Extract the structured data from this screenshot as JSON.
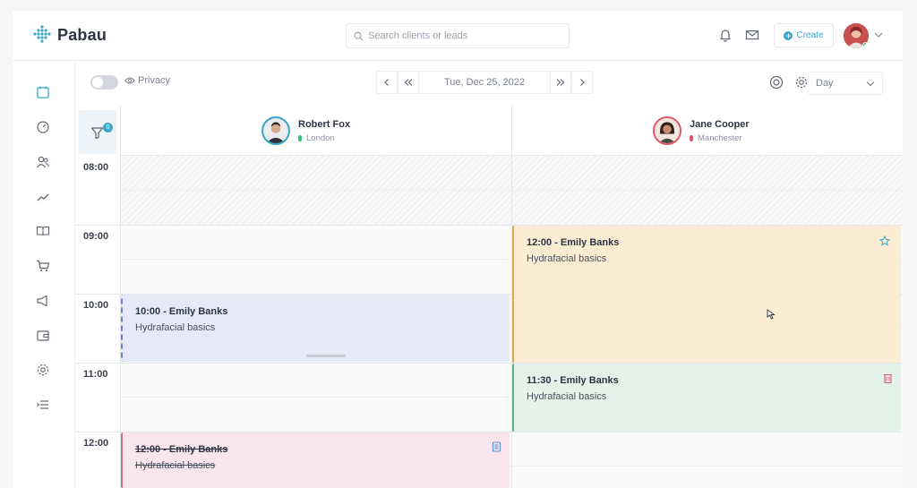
{
  "brand": {
    "name": "Pabau"
  },
  "header": {
    "search_placeholder": "Search clients or leads",
    "create_label": "Create",
    "icons": [
      "bell-icon",
      "mail-icon",
      "chevron-down-icon"
    ]
  },
  "sidebar": {
    "items": [
      "calendar-icon",
      "dashboard-icon",
      "clients-icon",
      "reports-icon",
      "book-icon",
      "cart-icon",
      "marketing-icon",
      "wallet-icon",
      "settings-icon",
      "list-icon"
    ]
  },
  "toolbar": {
    "privacy_label": "Privacy",
    "date": "Tue, Dec 25, 2022",
    "view": "Day"
  },
  "calendar": {
    "filter_count": "0",
    "staff": [
      {
        "name": "Robert Fox",
        "location": "London",
        "loc_color": "#34c17b"
      },
      {
        "name": "Jane Cooper",
        "location": "Manchester",
        "loc_color": "#e0566a"
      }
    ],
    "times": [
      "08:00",
      "09:00",
      "10:00",
      "11:00",
      "12:00"
    ],
    "appointments": [
      {
        "title": "10:00 - Emily Banks",
        "service": "Hydrafacial basics",
        "status": "booked",
        "color": "#e6e9f7"
      },
      {
        "title": "12:00 - Emily Banks",
        "service": "Hydrafacial basics",
        "status": "cancelled",
        "color": "#f8e6ec"
      },
      {
        "title": "12:00 - Emily Banks",
        "service": "Hydrafacial basics",
        "status": "starred",
        "color": "#fbedd4"
      },
      {
        "title": "11:30 - Emily Banks",
        "service": "Hydrafacial basics",
        "status": "deleted",
        "color": "#e4f3ea"
      }
    ]
  }
}
